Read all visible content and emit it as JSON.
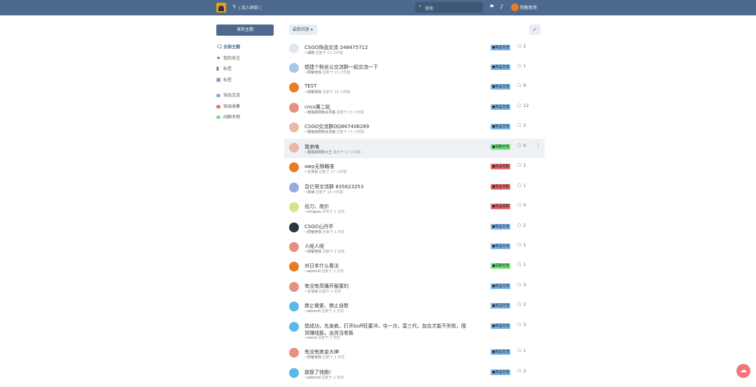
{
  "header": {
    "join_label": "| 加入群聊 |",
    "search_placeholder": "搜索",
    "user_name": "阴郁老铁"
  },
  "sidebar": {
    "post_button": "发布主题",
    "items": [
      {
        "label": "全部主题",
        "icon": "comments-icon"
      },
      {
        "label": "我的关注",
        "icon": "star-icon"
      },
      {
        "label": "标签",
        "icon": "tags-icon"
      },
      {
        "label": "标签",
        "icon": "grid-icon"
      }
    ],
    "tags": [
      {
        "label": "饰品交流",
        "color": "#7ab3e8"
      },
      {
        "label": "饰品收集",
        "color": "#e36a6a"
      },
      {
        "label": "闲聊天地",
        "color": "#6fe37a"
      }
    ]
  },
  "toolbar": {
    "sort_label": "最新回复 ▾",
    "check_label": "✓"
  },
  "colors": {
    "brand": "#4d698e",
    "trade": "#7ab3e8",
    "collect": "#e36a6a",
    "chat": "#6fe37a"
  },
  "discussions": [
    {
      "title": "CSGO饰品交流 248475712",
      "user": "湖镜",
      "time": "回复于 12 小时前",
      "tag": "饰品交流",
      "tag_color": "#7ab3e8",
      "count": "1",
      "avatar": "#dfe8f0"
    },
    {
      "title": "想建个粉丝公交流群一起交流一下",
      "user": "阴郁老铁",
      "time": "回复于 13 小时前",
      "tag": "饰品交流",
      "tag_color": "#7ab3e8",
      "count": "1",
      "avatar": "#a8c7e6"
    },
    {
      "title": "TEST",
      "user": "阴郁老铁",
      "time": "回复于 16 小时前",
      "tag": "饰品交流",
      "tag_color": "#7ab3e8",
      "count": "6",
      "avatar": "#e67e22"
    },
    {
      "title": "cncs第二贴",
      "user": "粗狼搞限制会员搬",
      "time": "回复于 17 小时前",
      "tag": "饰品交流",
      "tag_color": "#7ab3e8",
      "count": "12",
      "avatar": "#e59080"
    },
    {
      "title": "CSGO交流群QQ867406289",
      "user": "粗狼搞限制会员搬",
      "time": "回复于 17 小时前",
      "tag": "饰品交流",
      "tag_color": "#7ab3e8",
      "count": "2",
      "avatar": "#e9b8a6"
    },
    {
      "title": "我来咯",
      "user": "粗狼搞限制大王",
      "time": "发布于 17 小时前",
      "tag": "闲聊天地",
      "tag_color": "#6fe37a",
      "count": "0",
      "avatar": "#e9b8a6"
    },
    {
      "title": "awp无限瞄准",
      "user": "王哥哥",
      "time": "回复于 17 小时前",
      "tag": "饰品收集",
      "tag_color": "#e36a6a",
      "count": "1",
      "avatar": "#e67e22"
    },
    {
      "title": "百亿哥交流群 835623253",
      "user": "琉璃",
      "time": "回复于 18 小时前",
      "tag": "饰品收集",
      "tag_color": "#e36a6a",
      "count": "1",
      "avatar": "#98a9e0"
    },
    {
      "title": "出刀，底价",
      "user": "xingyou",
      "time": "发布于 1 天前",
      "tag": "饰品收集",
      "tag_color": "#e36a6a",
      "count": "0",
      "avatar": "#d5e58a"
    },
    {
      "title": "CSGO山丹亭",
      "user": "阴郁老铁",
      "time": "回复于 2 天前",
      "tag": "饰品交流",
      "tag_color": "#7ab3e8",
      "count": "2",
      "avatar": "#2c3440"
    },
    {
      "title": "人呢人呢",
      "user": "阴郁老铁",
      "time": "回复于 2 天前",
      "tag": "饰品交流",
      "tag_color": "#7ab3e8",
      "count": "1",
      "avatar": "#e59080"
    },
    {
      "title": "对日本什么看法",
      "user": "admin0",
      "time": "回复于 2 天前",
      "tag": "闲聊天地",
      "tag_color": "#6fe37a",
      "count": "1",
      "avatar": "#e67e22"
    },
    {
      "title": "有没有高播开服童的",
      "user": "王哥哥",
      "time": "回复于 2 天前",
      "tag": "饰品交流",
      "tag_color": "#7ab3e8",
      "count": "3",
      "avatar": "#e59080"
    },
    {
      "title": "禁止做爱、禁止自慰",
      "user": "admin0",
      "time": "回复于 2 天前",
      "tag": "饰品交流",
      "tag_color": "#7ab3e8",
      "count": "2",
      "avatar": "#5bb8e8"
    },
    {
      "title": "想成功，先发疯，打开buff狂置冲，屯一次，富三代，加合才能不失败，囤",
      "title2": "货赚钱板，出货当老板",
      "user": "recca",
      "time": "回复于 2 天前",
      "tag": "饰品交流",
      "tag_color": "#7ab3e8",
      "count": "3",
      "avatar": "#5bb8e8"
    },
    {
      "title": "有没有炼金大神",
      "user": "阴郁老铁",
      "time": "回复于 2 天前",
      "tag": "饰品交流",
      "tag_color": "#7ab3e8",
      "count": "1",
      "avatar": "#e59080"
    },
    {
      "title": "崩盘了快跑!",
      "user": "admin0",
      "time": "回复于 2 天前",
      "tag": "饰品交流",
      "tag_color": "#7ab3e8",
      "count": "2",
      "avatar": "#5bb8e8"
    }
  ]
}
